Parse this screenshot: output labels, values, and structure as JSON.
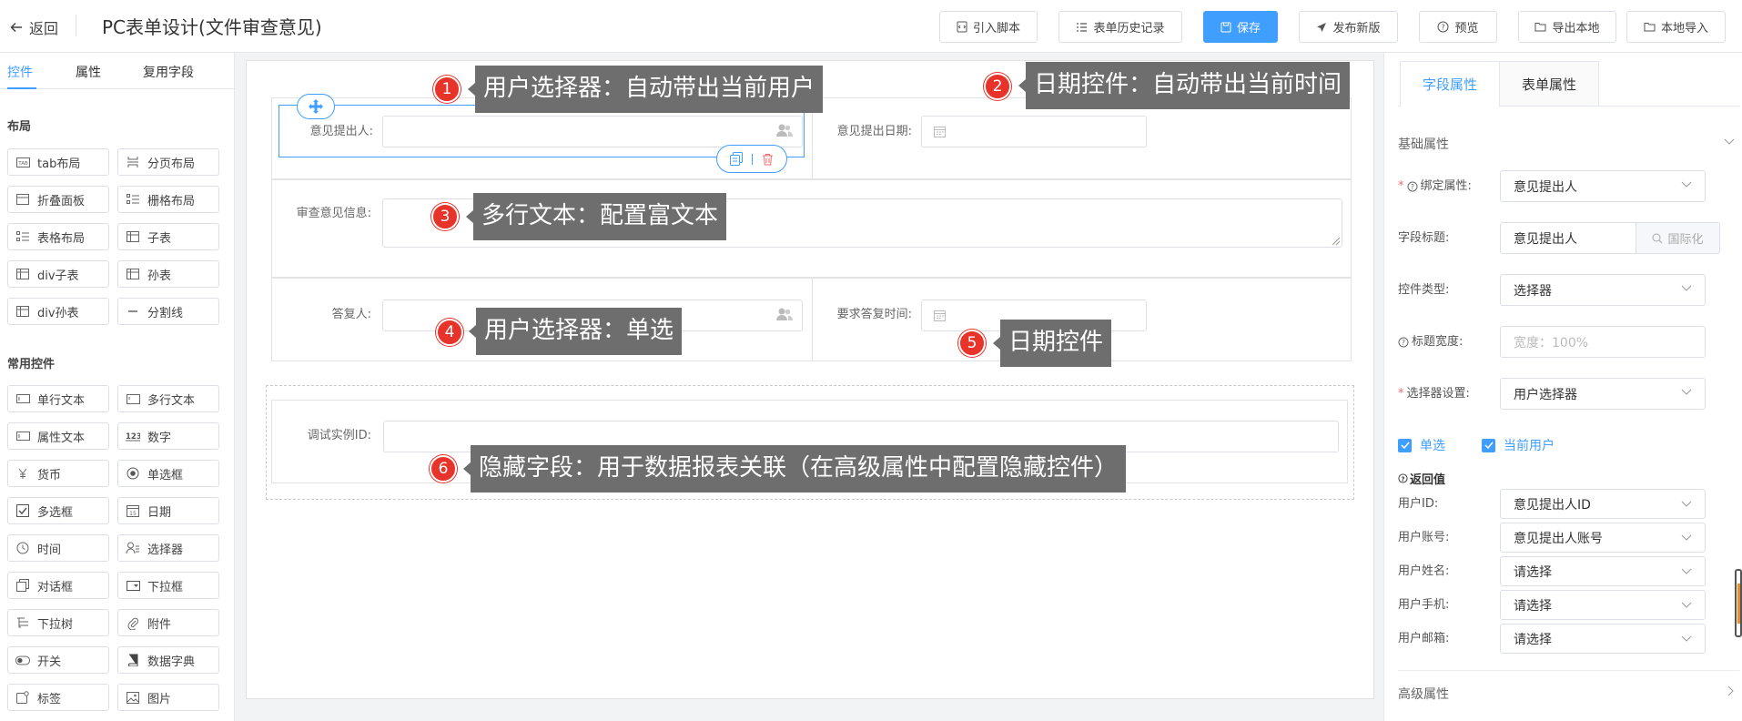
{
  "header": {
    "back_label": "返回",
    "title": "PC表单设计(文件审查意见)",
    "buttons": {
      "import_script": "引入脚本",
      "history": "表单历史记录",
      "save": "保存",
      "publish": "发布新版",
      "preview": "预览",
      "export_local": "导出本地",
      "import_local": "本地导入"
    }
  },
  "left_panel": {
    "tabs": [
      "控件",
      "属性",
      "复用字段"
    ],
    "layout_section": "布局",
    "layout_items": [
      "tab布局",
      "分页布局",
      "折叠面板",
      "栅格布局",
      "表格布局",
      "子表",
      "div子表",
      "孙表",
      "div孙表",
      "分割线"
    ],
    "common_section": "常用控件",
    "common_items": [
      "单行文本",
      "多行文本",
      "属性文本",
      "数字",
      "货币",
      "单选框",
      "多选框",
      "日期",
      "时间",
      "选择器",
      "对话框",
      "下拉框",
      "下拉树",
      "附件",
      "开关",
      "数据字典",
      "标签",
      "图片"
    ]
  },
  "form": {
    "field_proposer": "意见提出人:",
    "field_propose_date": "意见提出日期:",
    "field_review_info": "审查意见信息:",
    "field_replier": "答复人:",
    "field_reply_time": "要求答复时间:",
    "field_debug_id": "调试实例ID:"
  },
  "callouts": [
    {
      "num": "1",
      "text": "用户选择器：自动带出当前用户"
    },
    {
      "num": "2",
      "text": "日期控件：自动带出当前时间"
    },
    {
      "num": "3",
      "text": "多行文本：配置富文本"
    },
    {
      "num": "4",
      "text": "用户选择器：单选"
    },
    {
      "num": "5",
      "text": "日期控件"
    },
    {
      "num": "6",
      "text": "隐藏字段：用于数据报表关联（在高级属性中配置隐藏控件）"
    }
  ],
  "right_panel": {
    "tabs": [
      "字段属性",
      "表单属性"
    ],
    "basic_section": "基础属性",
    "bind_label": "绑定属性:",
    "bind_value": "意见提出人",
    "field_title_label": "字段标题:",
    "field_title_value": "意见提出人",
    "i18n_label": "国际化",
    "control_type_label": "控件类型:",
    "control_type_value": "选择器",
    "title_width_label": "标题宽度:",
    "title_width_placeholder": "宽度：100%",
    "selector_setting_label": "选择器设置:",
    "selector_setting_value": "用户选择器",
    "single_label": "单选",
    "current_user_label": "当前用户",
    "return_value_label": "返回值",
    "return_fields": [
      {
        "label": "用户ID:",
        "value": "意见提出人ID"
      },
      {
        "label": "用户账号:",
        "value": "意见提出人账号"
      },
      {
        "label": "用户姓名:",
        "value": "请选择"
      },
      {
        "label": "用户手机:",
        "value": "请选择"
      },
      {
        "label": "用户邮箱:",
        "value": "请选择"
      }
    ],
    "advanced_section": "高级属性"
  },
  "colors": {
    "accent": "#409eff",
    "callout_bg": "#6e6e6e",
    "badge_red": "#e8332a",
    "delete_red": "#f56c6c"
  }
}
